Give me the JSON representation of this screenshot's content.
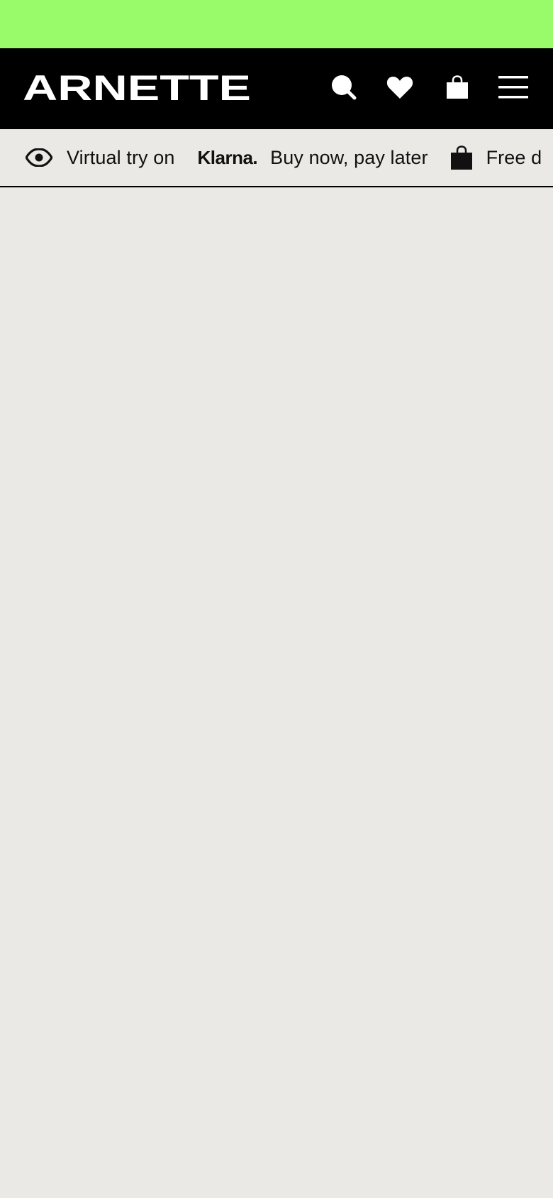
{
  "promo_bar": {
    "color": "#99fb6a"
  },
  "header": {
    "brand": "ARNETTE",
    "icons": [
      "search-icon",
      "heart-icon",
      "shopping-bag-icon",
      "hamburger-menu-icon"
    ]
  },
  "usp_bar": {
    "items": [
      {
        "icon": "eye-icon",
        "label": "Virtual try on"
      },
      {
        "logo": "Klarna.",
        "label": "Buy now, pay later"
      },
      {
        "icon": "shopping-bag-icon",
        "label": "Free d"
      }
    ]
  },
  "colors": {
    "accent": "#99fb6a",
    "header_bg": "#000000",
    "page_bg": "#eae9e5"
  }
}
